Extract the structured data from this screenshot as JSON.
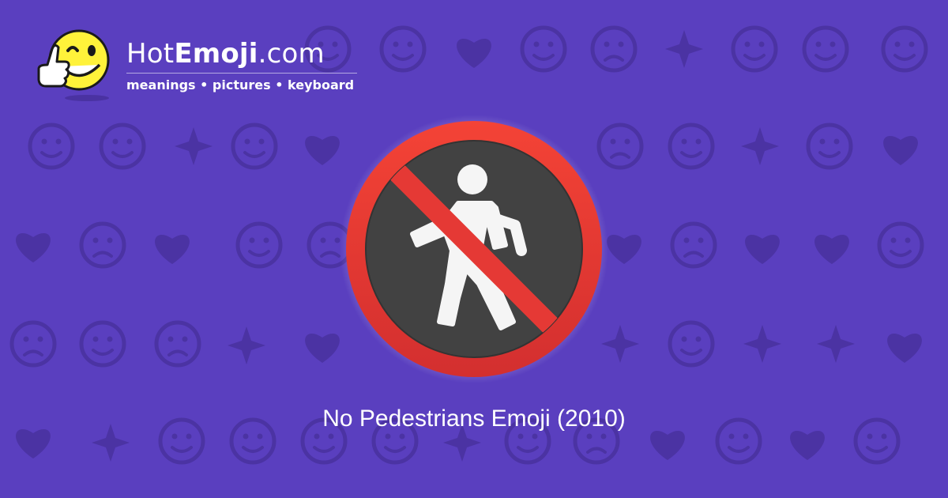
{
  "brand": {
    "name_regular": "Hot",
    "name_bold": "Emoji",
    "name_tld": ".com",
    "tagline": "meanings • pictures • keyboard",
    "logo_icon": "winking-thumbs-up-smiley-icon"
  },
  "emoji": {
    "caption": "No Pedestrians Emoji (2010)",
    "icon": "no-pedestrians-icon"
  },
  "colors": {
    "background": "#5a3fbf",
    "pattern": "#4b33a3",
    "ring_red": "#e53935",
    "disc_dark": "#424242",
    "figure": "#f5f5f5",
    "logo_yellow": "#fff23a"
  }
}
